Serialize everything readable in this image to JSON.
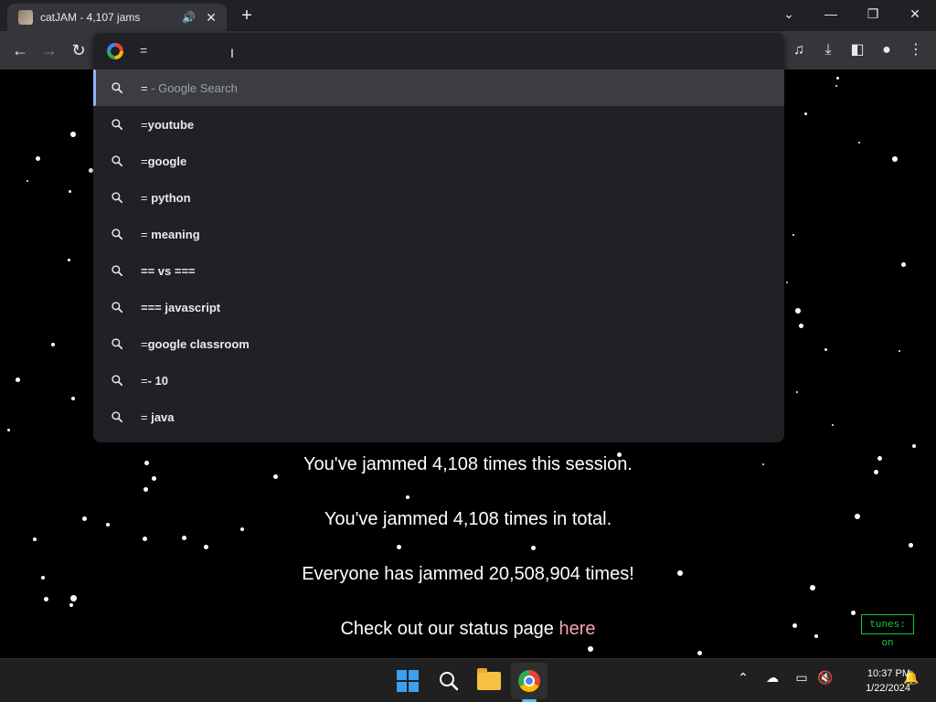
{
  "browser": {
    "tab": {
      "title": "catJAM - 4,107 jams"
    },
    "window_controls": {
      "dropdown": "⌄",
      "minimize": "—",
      "restore": "❐",
      "close": "✕"
    },
    "omnibox": {
      "value": "="
    }
  },
  "suggestions": [
    {
      "prefix": "= ",
      "text": "- Google Search",
      "style": "google-search"
    },
    {
      "prefix": "=",
      "text": "youtube"
    },
    {
      "prefix": "=",
      "text": "google"
    },
    {
      "prefix": "= ",
      "text": "python"
    },
    {
      "prefix": "= ",
      "text": "meaning"
    },
    {
      "prefix": "",
      "text": "== vs ==="
    },
    {
      "prefix": "",
      "text": "=== javascript"
    },
    {
      "prefix": "=",
      "text": "google classroom"
    },
    {
      "prefix": "=",
      "text": "- 10"
    },
    {
      "prefix": "= ",
      "text": "java"
    }
  ],
  "page": {
    "session_text": "You've jammed 4,108 times this session.",
    "total_text": "You've jammed 4,108 times in total.",
    "everyone_text": "Everyone has jammed 20,508,904 times!",
    "status_prefix": "Check out our status page ",
    "status_link": "here",
    "tunes_badge": "tunes: on"
  },
  "taskbar": {
    "time": "10:37 PM",
    "date": "1/22/2024"
  },
  "colors": {
    "link": "#f5a3b3",
    "tunes_green": "#19c23b",
    "selection_accent": "#8ab4f8"
  }
}
